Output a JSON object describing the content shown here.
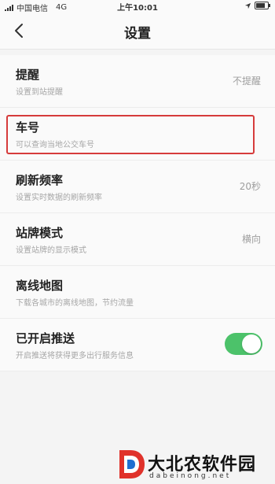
{
  "status_bar": {
    "carrier": "中国电信",
    "network": "4G",
    "time": "上午10:01",
    "icons": [
      "signal-icon",
      "location-arrow-icon",
      "battery-icon"
    ]
  },
  "header": {
    "title": "设置",
    "back_icon": "chevron-left-icon"
  },
  "settings": [
    {
      "label": "提醒",
      "desc": "设置到站提醒",
      "value": "不提醒"
    },
    {
      "label": "车号",
      "desc": "可以查询当地公交车号",
      "value": ""
    },
    {
      "label": "刷新频率",
      "desc": "设置实时数据的刷新频率",
      "value": "20秒"
    },
    {
      "label": "站牌模式",
      "desc": "设置站牌的显示模式",
      "value": "横向"
    },
    {
      "label": "离线地图",
      "desc": "下载各城市的离线地图，节约流量",
      "value": ""
    },
    {
      "label": "已开启推送",
      "desc": "开启推送将获得更多出行服务信息",
      "toggle_on": true
    }
  ],
  "colors": {
    "highlight_border": "#d63b3b",
    "toggle_on": "#4cc26a"
  },
  "watermark": {
    "text_cn": "大北农软件园",
    "text_en": "dabeinong.net"
  }
}
